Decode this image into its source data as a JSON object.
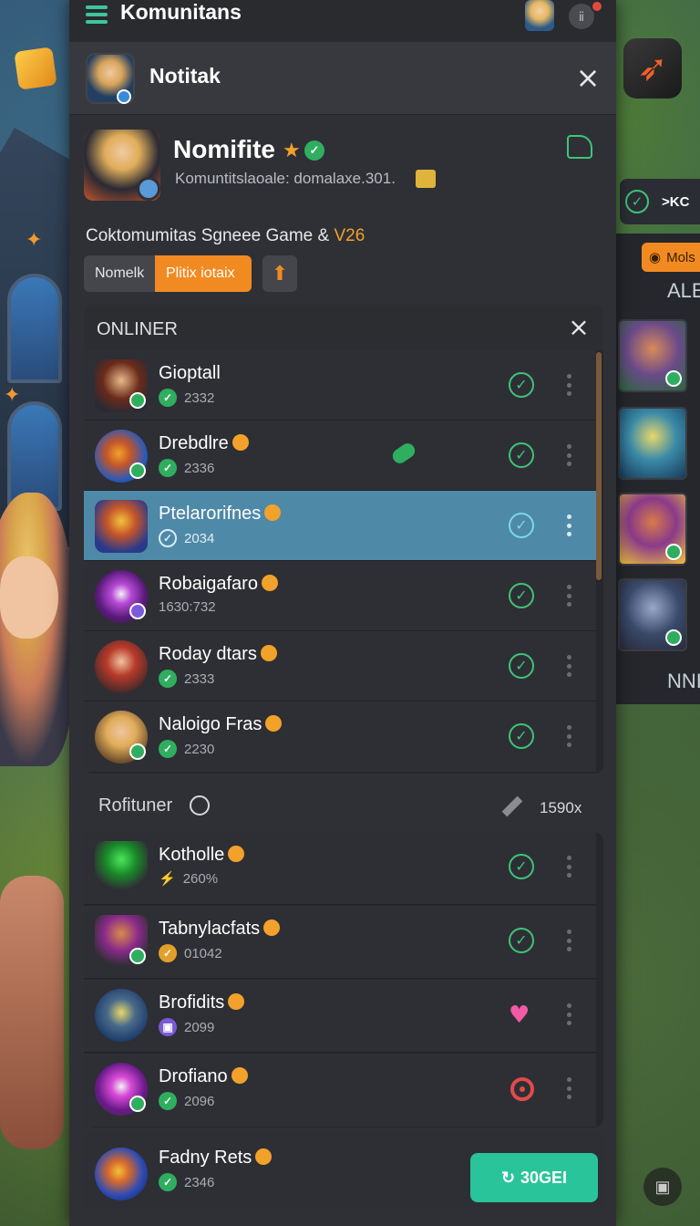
{
  "app": {
    "title": "Komunitans"
  },
  "header": {
    "title": "Notitak"
  },
  "profile": {
    "name": "Nomifite",
    "subtitle": "Komuntitslaoale: domalaxe.301.",
    "community_line_prefix": "Coktomumitas Sgneee Game & ",
    "community_line_accent": "V26"
  },
  "pills": {
    "normal": "Nomelk",
    "active": "Plitix iotaix"
  },
  "online": {
    "title": "ONLINER",
    "rows": [
      {
        "name": "Gioptall",
        "sub": "2332",
        "verified": "check"
      },
      {
        "name": "Drebdlre",
        "sub": "2336",
        "verified": "check"
      },
      {
        "name": "Ptelarorifnes",
        "sub": "2034",
        "verified": "outline"
      },
      {
        "name": "Robaigafaro",
        "sub": "1630:732",
        "verified": ""
      },
      {
        "name": "Roday dtars",
        "sub": "2333",
        "verified": "check"
      },
      {
        "name": "Naloigo Fras",
        "sub": "2230",
        "verified": "check"
      }
    ]
  },
  "favorites": {
    "title": "Rofituner",
    "count": "1590x",
    "rows": [
      {
        "name": "Kotholle",
        "sub": "260%"
      },
      {
        "name": "Tabnylacfats",
        "sub": "01042"
      },
      {
        "name": "Brofidits",
        "sub": "2099"
      },
      {
        "name": "Drofiano",
        "sub": "2096"
      }
    ]
  },
  "bottom": {
    "name": "Fadny Rets",
    "sub": "2346",
    "button_label": "30GEI"
  },
  "right_panel": {
    "tab_text": ">KC",
    "mods_label": "Mols",
    "label_top": "ALE",
    "label_bottom": "NNI"
  },
  "icons": {
    "menu": "hamburger-icon",
    "close": "close-icon",
    "verified": "verified-check-icon",
    "more": "more-vertical-icon",
    "heart": "heart-icon",
    "target": "target-icon",
    "share": "share-icon",
    "clock": "clock-icon",
    "pen": "pen-icon",
    "lock": "lock-icon"
  },
  "colors": {
    "accent_orange": "#f28a22",
    "accent_green": "#2fae5f",
    "selected_row": "#4f89a8",
    "action_button": "#2ac49a"
  }
}
